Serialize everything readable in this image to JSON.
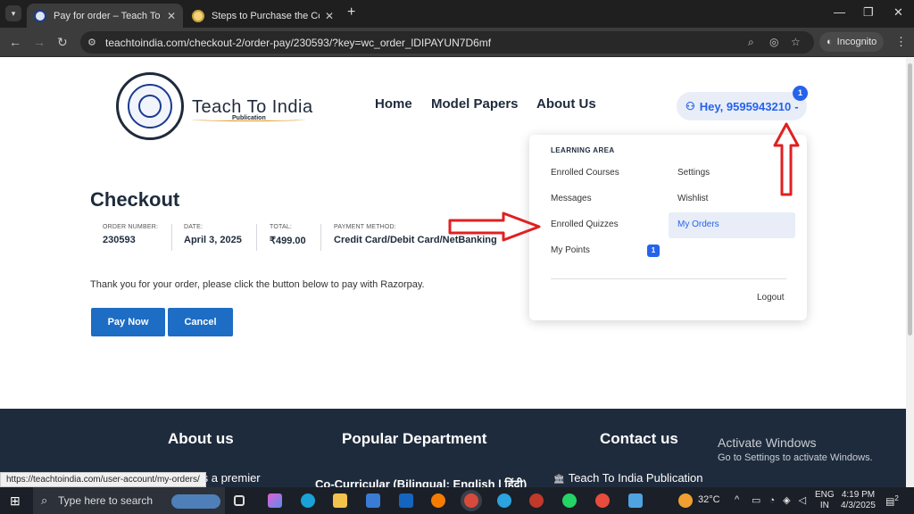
{
  "browser": {
    "tabs": [
      {
        "title": "Pay for order – Teach To India",
        "active": true
      },
      {
        "title": "Steps to Purchase the Course -",
        "active": false
      }
    ],
    "url": "teachtoindia.com/checkout-2/order-pay/230593/?key=wc_order_lDIPAYUN7D6mf",
    "incognito_label": "Incognito"
  },
  "header": {
    "brand": "Teach To India",
    "brand_sub": "Publication",
    "nav": [
      "Home",
      "Model Papers",
      "About Us"
    ],
    "user_greeting": "Hey, 9595943210",
    "notification_count": "1"
  },
  "checkout": {
    "title": "Checkout",
    "order_number_label": "ORDER NUMBER:",
    "order_number": "230593",
    "date_label": "DATE:",
    "date": "April 3, 2025",
    "total_label": "TOTAL:",
    "total": "₹499.00",
    "payment_label": "PAYMENT METHOD:",
    "payment": "Credit Card/Debit Card/NetBanking",
    "thanks": "Thank you for your order, please click the button below to pay with Razorpay.",
    "pay_now": "Pay Now",
    "cancel": "Cancel"
  },
  "dropdown": {
    "section": "LEARNING AREA",
    "left": [
      "Enrolled Courses",
      "Messages",
      "Enrolled Quizzes",
      "My Points"
    ],
    "right": [
      "Settings",
      "Wishlist",
      "My Orders"
    ],
    "points_badge": "1",
    "logout": "Logout",
    "selected": "My Orders"
  },
  "footer": {
    "headings": [
      "About us",
      "Popular Department",
      "Contact us"
    ],
    "about_text": "ia is a premier",
    "dept_text": "Co-Curricular (Bilingual: English | हिंदी)",
    "contact_text": "Teach To India Publication"
  },
  "windows": {
    "activate_title": "Activate Windows",
    "activate_sub": "Go to Settings to activate Windows.",
    "status_url": "https://teachtoindia.com/user-account/my-orders/",
    "search_placeholder": "Type here to search",
    "temperature": "32°C",
    "lang": "ENG",
    "region": "IN",
    "time": "4:19 PM",
    "date": "4/3/2025",
    "notif": "2"
  },
  "colors": {
    "accent": "#2563eb",
    "dark": "#1e2b3c",
    "button": "#1d6dc4",
    "annotation": "#e02020"
  }
}
